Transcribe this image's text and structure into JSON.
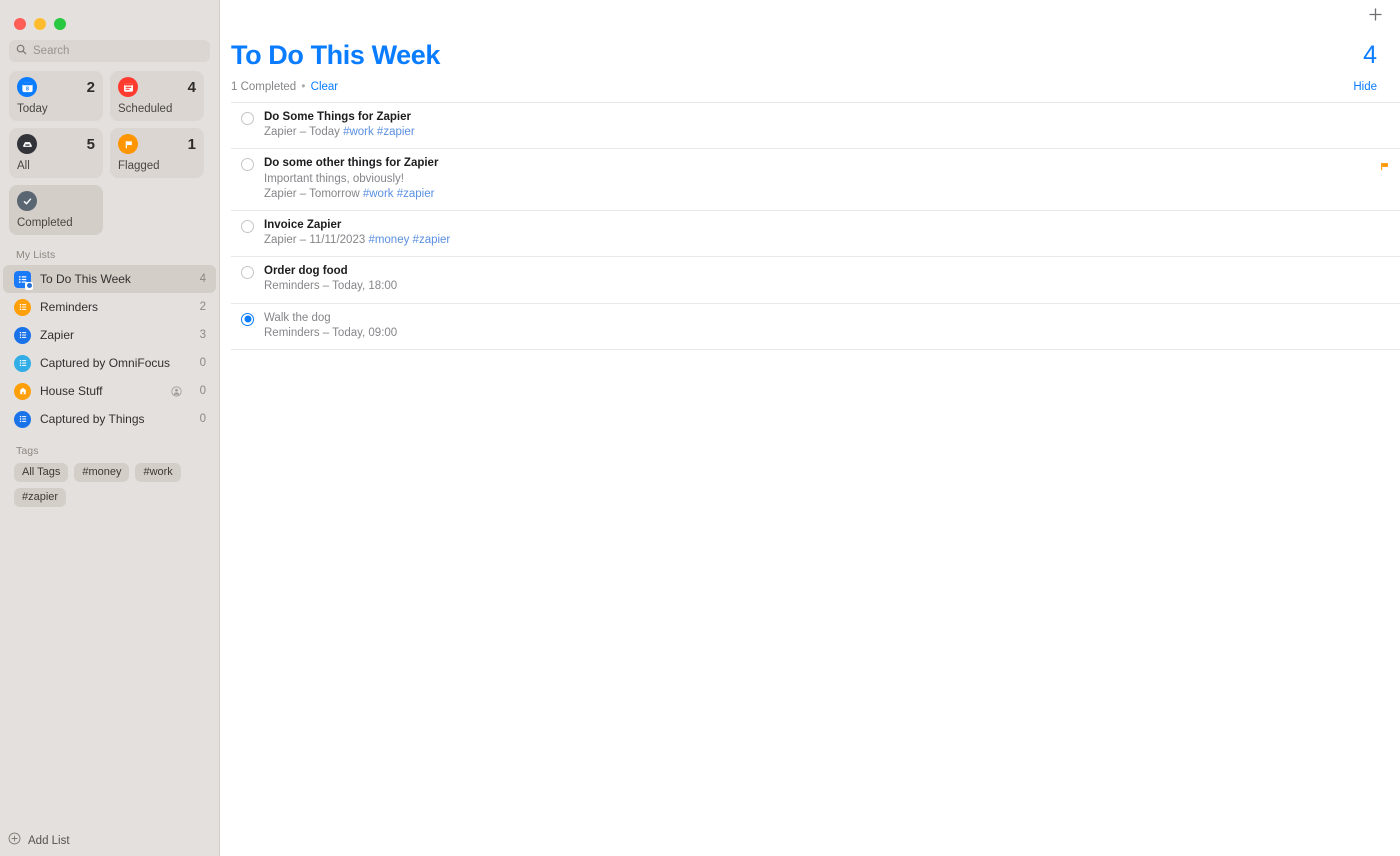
{
  "window": {
    "traffic_lights": [
      "close",
      "minimize",
      "zoom"
    ],
    "colors": {
      "accent": "#0a7cff",
      "sidebar_bg": "#e4e0dd",
      "card_bg": "#dbd6d2",
      "selected_bg": "#d4cec9",
      "tag_blue": "#5a8fe0",
      "flag_orange": "#ff9500",
      "red": "#ff3b30",
      "orange": "#ff9500",
      "light_blue": "#32ade6",
      "gray": "#5a6672"
    }
  },
  "sidebar": {
    "search": {
      "placeholder": "Search",
      "value": "",
      "icon": "search-icon"
    },
    "smart_lists": [
      {
        "label": "Today",
        "count": "2",
        "icon": "calendar-today-icon",
        "icon_color": "#0a7cff",
        "selected": false
      },
      {
        "label": "Scheduled",
        "count": "4",
        "icon": "calendar-icon",
        "icon_color": "#ff3b30",
        "selected": false
      },
      {
        "label": "All",
        "count": "5",
        "icon": "inbox-tray-icon",
        "icon_color": "#3c3c41",
        "selected": false
      },
      {
        "label": "Flagged",
        "count": "1",
        "icon": "flag-icon",
        "icon_color": "#ff9500",
        "selected": false
      },
      {
        "label": "Completed",
        "count": "",
        "icon": "checkmark-icon",
        "icon_color": "#5a6672",
        "selected": true
      }
    ],
    "my_lists_header": "My Lists",
    "lists": [
      {
        "label": "To Do This Week",
        "count": "4",
        "icon": "smart-list-icon",
        "icon_color": "#1a7af8",
        "selected": true,
        "shared": false,
        "smart": true
      },
      {
        "label": "Reminders",
        "count": "2",
        "icon": "list-icon",
        "icon_color": "#ff9f0a",
        "selected": false,
        "shared": false,
        "smart": false
      },
      {
        "label": "Zapier",
        "count": "3",
        "icon": "list-icon",
        "icon_color": "#1a73e8",
        "selected": false,
        "shared": false,
        "smart": false
      },
      {
        "label": "Captured by OmniFocus",
        "count": "0",
        "icon": "list-icon",
        "icon_color": "#32ade6",
        "selected": false,
        "shared": false,
        "smart": false
      },
      {
        "label": "House Stuff",
        "count": "0",
        "icon": "house-icon",
        "icon_color": "#ff9f0a",
        "selected": false,
        "shared": true,
        "smart": false
      },
      {
        "label": "Captured by Things",
        "count": "0",
        "icon": "list-icon",
        "icon_color": "#1a73e8",
        "selected": false,
        "shared": false,
        "smart": false
      }
    ],
    "tags_header": "Tags",
    "tags": [
      "All Tags",
      "#money",
      "#work",
      "#zapier"
    ],
    "add_list": {
      "label": "Add List",
      "icon": "plus-circle-icon"
    }
  },
  "main": {
    "add_button_icon": "plus-icon",
    "title": "To Do This Week",
    "count": "4",
    "completed_text": "1 Completed",
    "separator": "•",
    "clear_label": "Clear",
    "hide_label": "Hide",
    "tasks": [
      {
        "title": "Do Some Things for Zapier",
        "note": "",
        "source": "Zapier – Today ",
        "tags": "#work #zapier",
        "completed": false,
        "flagged": false
      },
      {
        "title": "Do some other things for Zapier",
        "note": "Important things, obviously!",
        "source": "Zapier – Tomorrow ",
        "tags": "#work #zapier",
        "completed": false,
        "flagged": true
      },
      {
        "title": "Invoice Zapier",
        "note": "",
        "source": "Zapier – 11/11/2023 ",
        "tags": "#money #zapier",
        "completed": false,
        "flagged": false
      },
      {
        "title": "Order dog food",
        "note": "",
        "source": "Reminders – Today, 18:00",
        "tags": "",
        "completed": false,
        "flagged": false
      },
      {
        "title": "Walk the dog",
        "note": "",
        "source": "Reminders – Today, 09:00",
        "tags": "",
        "completed": true,
        "flagged": false
      }
    ]
  }
}
